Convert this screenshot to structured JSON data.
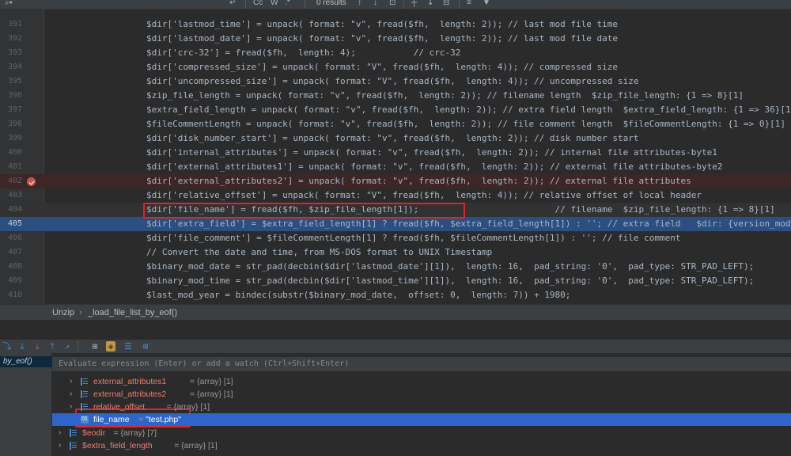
{
  "find_bar": {
    "results": "0 results",
    "match_case": "Cc",
    "words": "W",
    "regex": ".*"
  },
  "editor": {
    "lines": [
      {
        "n": "391",
        "code": "$dir['lastmod_time'] = unpack( format: \"v\", fread($fh,  length: 2)); // last mod file time"
      },
      {
        "n": "392",
        "code": "$dir['lastmod_date'] = unpack( format: \"v\", fread($fh,  length: 2)); // last mod file date"
      },
      {
        "n": "393",
        "code": "$dir['crc-32'] = fread($fh,  length: 4);           // crc-32"
      },
      {
        "n": "394",
        "code": "$dir['compressed_size'] = unpack( format: \"V\", fread($fh,  length: 4)); // compressed size"
      },
      {
        "n": "395",
        "code": "$dir['uncompressed_size'] = unpack( format: \"V\", fread($fh,  length: 4)); // uncompressed size"
      },
      {
        "n": "396",
        "code": "$zip_file_length = unpack( format: \"v\", fread($fh,  length: 2)); // filename length  $zip_file_length: {1 => 8}[1]"
      },
      {
        "n": "397",
        "code": "$extra_field_length = unpack( format: \"v\", fread($fh,  length: 2)); // extra field length  $extra_field_length: {1 => 36}[1]"
      },
      {
        "n": "398",
        "code": "$fileCommentLength = unpack( format: \"v\", fread($fh,  length: 2)); // file comment length  $fileCommentLength: {1 => 0}[1]"
      },
      {
        "n": "399",
        "code": "$dir['disk_number_start'] = unpack( format: \"v\", fread($fh,  length: 2)); // disk number start"
      },
      {
        "n": "400",
        "code": "$dir['internal_attributes'] = unpack( format: \"v\", fread($fh,  length: 2)); // internal file attributes-byte1"
      },
      {
        "n": "401",
        "code": "$dir['external_attributes1'] = unpack( format: \"v\", fread($fh,  length: 2)); // external file attributes-byte2"
      },
      {
        "n": "402",
        "code": "$dir['external_attributes2'] = unpack( format: \"v\", fread($fh,  length: 2)); // external file attributes"
      },
      {
        "n": "403",
        "code": "$dir['relative_offset'] = unpack( format: \"V\", fread($fh,  length: 4)); // relative offset of local header"
      },
      {
        "n": "404",
        "code": "$dir['file_name'] = fread($fh, $zip_file_length[1]);                          // filename  $zip_file_length: {1 => 8}[1]"
      },
      {
        "n": "405",
        "code": "$dir['extra_field'] = $extra_field_length[1] ? fread($fh, $extra_field_length[1]) : ''; // extra field   $dir: {version_mod"
      },
      {
        "n": "406",
        "code": "$dir['file_comment'] = $fileCommentLength[1] ? fread($fh, $fileCommentLength[1]) : ''; // file comment"
      },
      {
        "n": "407",
        "code": "// Convert the date and time, from MS-DOS format to UNIX Timestamp"
      },
      {
        "n": "408",
        "code": "$binary_mod_date = str_pad(decbin($dir['lastmod_date'][1]),  length: 16,  pad_string: '0',  pad_type: STR_PAD_LEFT);"
      },
      {
        "n": "409",
        "code": "$binary_mod_time = str_pad(decbin($dir['lastmod_time'][1]),  length: 16,  pad_string: '0',  pad_type: STR_PAD_LEFT);"
      },
      {
        "n": "410",
        "code": "$last_mod_year = bindec(substr($binary_mod_date,  offset: 0,  length: 7)) + 1980;"
      }
    ]
  },
  "breadcrumb": {
    "class": "Unzip",
    "separator": "›",
    "method": "_load_file_list_by_eof()"
  },
  "debugger": {
    "frame": "by_eof()",
    "eval_placeholder": "Evaluate expression (Enter) or add a watch (Ctrl+Shift+Enter)",
    "vars": [
      {
        "name": "external_attributes1",
        "value": "{array} [1]"
      },
      {
        "name": "external_attributes2",
        "value": "{array} [1]"
      },
      {
        "name": "relative_offset",
        "value": "{array} [1]"
      },
      {
        "name": "file_name",
        "value": "\"test.php\""
      },
      {
        "name": "$eodir",
        "value": "{array} [7]"
      },
      {
        "name": "$extra_field_length",
        "value": "{array} [1]"
      }
    ]
  },
  "colors": {
    "highlight_box": "#e0242a",
    "selection": "#2f65ca",
    "breakpoint": "#c75450"
  }
}
